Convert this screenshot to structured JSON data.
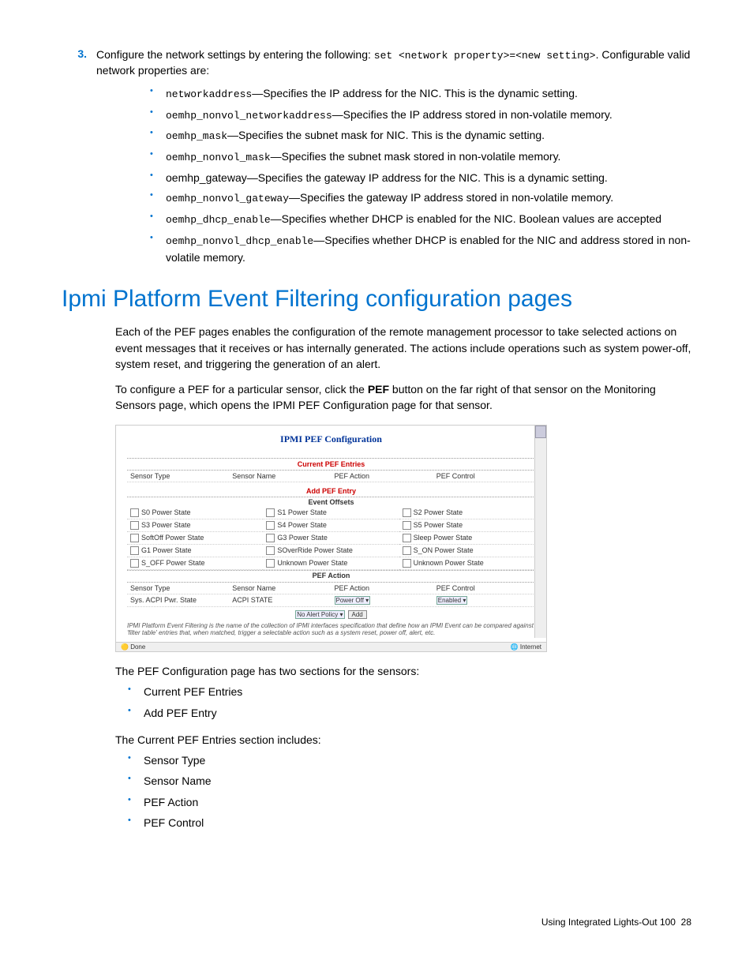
{
  "step": {
    "number": "3.",
    "text_before": "Configure the network settings by entering the following: ",
    "cmd": "set <network property>=<new setting>",
    "text_after": ". Configurable valid network properties are:"
  },
  "netprops": [
    {
      "code": "networkaddress",
      "desc": "—Specifies the IP address for the NIC. This is the dynamic setting."
    },
    {
      "code": "oemhp_nonvol_networkaddress",
      "desc": "—Specifies the IP address stored in non-volatile memory."
    },
    {
      "code": "oemhp_mask",
      "desc": "—Specifies the subnet mask for NIC. This is the dynamic setting."
    },
    {
      "code": "oemhp_nonvol_mask",
      "desc": "—Specifies the subnet mask stored in non-volatile memory."
    },
    {
      "code": "oemhp_gateway",
      "desc": "—Specifies the gateway IP address for the NIC. This is a dynamic setting.",
      "plain": true
    },
    {
      "code": "oemhp_nonvol_gateway",
      "desc": "—Specifies the gateway IP address stored in non-volatile memory."
    },
    {
      "code": "oemhp_dhcp_enable",
      "desc": "—Specifies whether DHCP is enabled for the NIC. Boolean values are accepted"
    },
    {
      "code": "oemhp_nonvol_dhcp_enable",
      "desc": "—Specifies whether DHCP is enabled for the NIC and address stored in non-volatile memory."
    }
  ],
  "heading": "Ipmi Platform Event Filtering configuration pages",
  "para1": "Each of the PEF pages enables the configuration of the remote management processor to take selected actions on event messages that it receives or has internally generated. The actions include operations such as system power-off, system reset, and triggering the generation of an alert.",
  "para2a": "To configure a PEF for a particular sensor, click the ",
  "para2b": "PEF",
  "para2c": " button on the far right of that sensor on the Monitoring Sensors page, which opens the IPMI PEF Configuration page for that sensor.",
  "screenshot": {
    "title": "IPMI PEF Configuration",
    "current_heading": "Current PEF Entries",
    "cols": {
      "c1": "Sensor Type",
      "c2": "Sensor Name",
      "c3": "PEF Action",
      "c4": "PEF Control"
    },
    "add_heading": "Add PEF Entry",
    "offsets_heading": "Event Offsets",
    "offsets": [
      "S0 Power State",
      "S1 Power State",
      "S2 Power State",
      "S3 Power State",
      "S4 Power State",
      "S5 Power State",
      "SoftOff Power State",
      "G3 Power State",
      "Sleep Power State",
      "G1 Power State",
      "SOverRide Power State",
      "S_ON Power State",
      "S_OFF Power State",
      "Unknown Power State",
      "Unknown Power State"
    ],
    "action_heading": "PEF Action",
    "row2": {
      "c1": "Sensor Type",
      "c2": "Sensor Name",
      "c3": "PEF Action",
      "c4": "PEF Control"
    },
    "row3": {
      "c1": "Sys. ACPI Pwr. State",
      "c2": "ACPI STATE",
      "c3": "Power Off",
      "c4": "Enabled"
    },
    "alert_policy": "No Alert Policy",
    "add_btn": "Add",
    "desc": "IPMI Platform Event Filtering is the name of the collection of IPMI interfaces specification that define how an IPMI Event can be compared against 'filter table' entries that, when matched, trigger a selectable action such as a system reset, power off, alert, etc.",
    "status_left": "Done",
    "status_right": "Internet"
  },
  "after1": "The PEF Configuration page has two sections for the sensors:",
  "sections": [
    "Current PEF Entries",
    "Add PEF Entry"
  ],
  "after2": "The Current PEF Entries section includes:",
  "includes": [
    "Sensor Type",
    "Sensor Name",
    "PEF Action",
    "PEF Control"
  ],
  "footer": {
    "text": "Using Integrated Lights-Out 100",
    "page": "28"
  }
}
